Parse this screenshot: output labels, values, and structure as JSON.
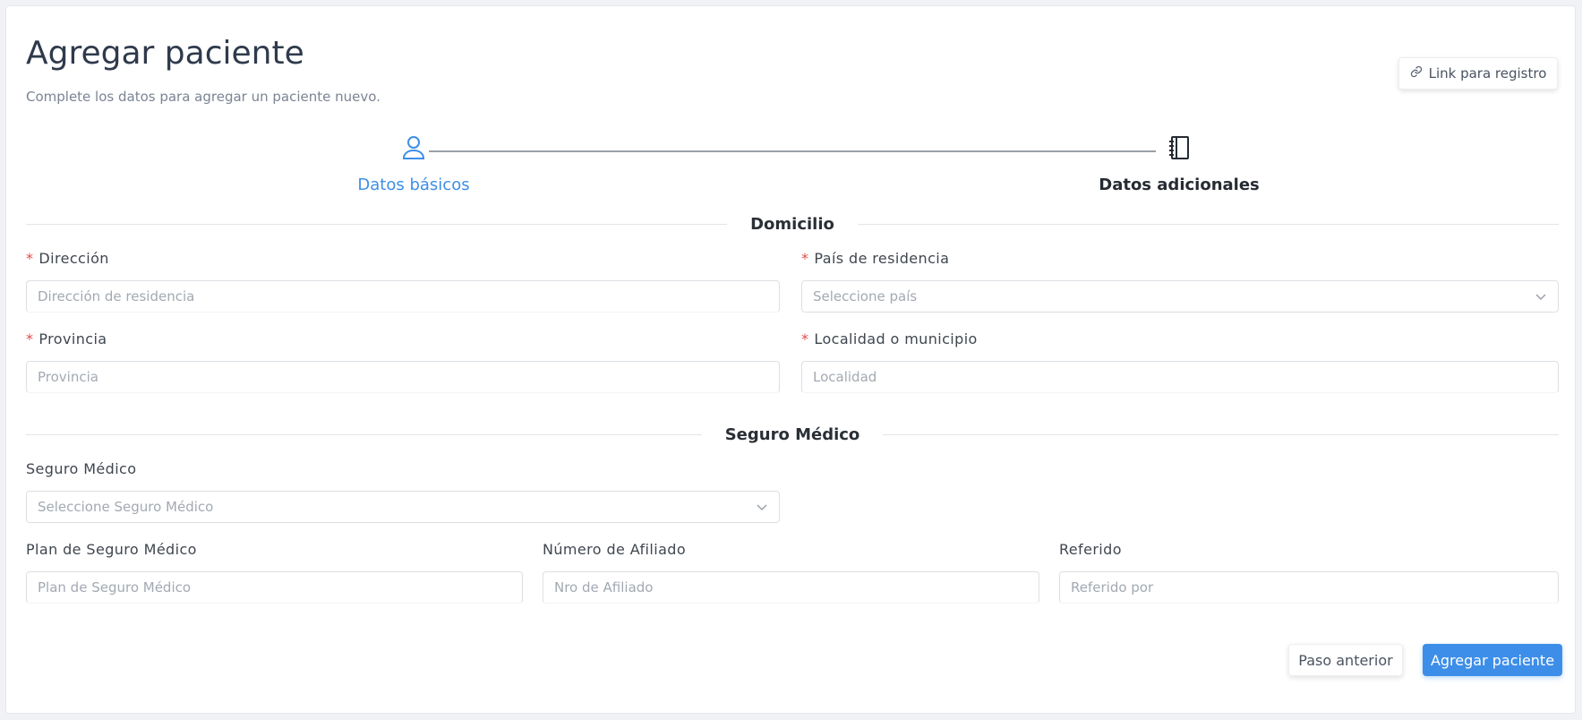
{
  "header": {
    "title": "Agregar paciente",
    "subtitle": "Complete los datos para agregar un paciente nuevo.",
    "register_link_label": "Link para registro",
    "register_link_icon": "link-icon"
  },
  "steps": [
    {
      "label": "Datos básicos",
      "icon": "user-icon",
      "state": "done"
    },
    {
      "label": "Datos adicionales",
      "icon": "notebook-icon",
      "state": "active"
    }
  ],
  "sections": {
    "address": "Domicilio",
    "insurance": "Seguro Médico"
  },
  "fields": {
    "address": {
      "label": "Dirección",
      "required": "*",
      "placeholder": "Dirección de residencia"
    },
    "country": {
      "label": "País de residencia",
      "required": "*",
      "placeholder": "Seleccione país"
    },
    "province": {
      "label": "Provincia",
      "required": "*",
      "placeholder": "Provincia"
    },
    "locality": {
      "label": "Localidad o municipio",
      "required": "*",
      "placeholder": "Localidad"
    },
    "insurance": {
      "label": "Seguro Médico",
      "placeholder": "Seleccione Seguro Médico"
    },
    "plan": {
      "label": "Plan de Seguro Médico",
      "placeholder": "Plan de Seguro Médico"
    },
    "member_number": {
      "label": "Número de Afiliado",
      "placeholder": "Nro de Afiliado"
    },
    "referred": {
      "label": "Referido",
      "placeholder": "Referido por"
    }
  },
  "footer": {
    "prev_label": "Paso anterior",
    "submit_label": "Agregar paciente"
  },
  "colors": {
    "primary": "#3d8ee8",
    "required": "#e34b4b",
    "title": "#2f3a4c"
  }
}
